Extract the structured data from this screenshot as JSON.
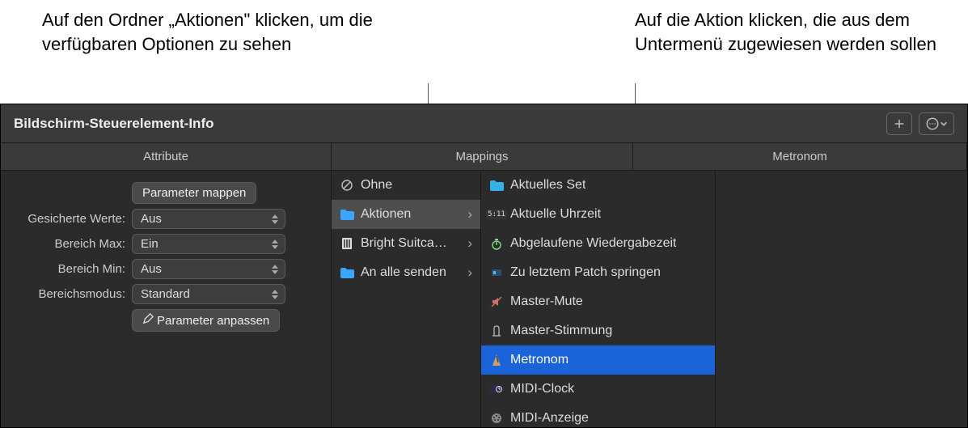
{
  "callouts": {
    "left": "Auf den Ordner „Aktionen\" klicken, um die verfügbaren Optionen zu sehen",
    "right": "Auf die Aktion klicken, die aus dem Untermenü zugewiesen werden sollen"
  },
  "window_title": "Bildschirm-Steuerelement-Info",
  "tabs": {
    "attribute": "Attribute",
    "mappings": "Mappings",
    "metronom": "Metronom"
  },
  "attributes": {
    "map_button": "Parameter mappen",
    "saved_label": "Gesicherte Werte:",
    "saved_value": "Aus",
    "max_label": "Bereich Max:",
    "max_value": "Ein",
    "min_label": "Bereich Min:",
    "min_value": "Aus",
    "mode_label": "Bereichsmodus:",
    "mode_value": "Standard",
    "edit_button": "Parameter anpassen"
  },
  "col1": [
    {
      "icon": "none",
      "label": "Ohne",
      "chev": false,
      "sel": false
    },
    {
      "icon": "folder-blue",
      "label": "Aktionen",
      "chev": true,
      "sel": true
    },
    {
      "icon": "concert",
      "label": "Bright Suitca…",
      "chev": true,
      "sel": false
    },
    {
      "icon": "folder-blue",
      "label": "An alle senden",
      "chev": true,
      "sel": false
    }
  ],
  "col2": [
    {
      "icon": "folder-cyan",
      "label": "Aktuelles Set"
    },
    {
      "icon": "clock-digital",
      "label": "Aktuelle Uhrzeit"
    },
    {
      "icon": "stopwatch",
      "label": "Abgelaufene Wiedergabezeit"
    },
    {
      "icon": "patch",
      "label": "Zu letztem Patch springen"
    },
    {
      "icon": "mute",
      "label": "Master-Mute"
    },
    {
      "icon": "tuning",
      "label": "Master-Stimmung"
    },
    {
      "icon": "metronome",
      "label": "Metronom",
      "selblue": true
    },
    {
      "icon": "midi-clock",
      "label": "MIDI-Clock"
    },
    {
      "icon": "midi",
      "label": "MIDI-Anzeige"
    }
  ]
}
